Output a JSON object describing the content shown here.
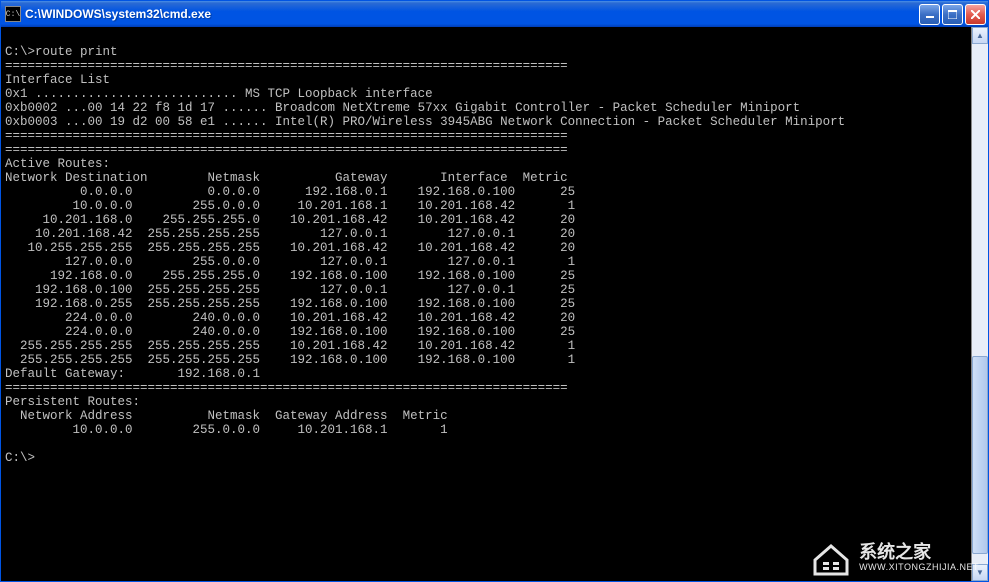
{
  "window": {
    "icon_text": "C:\\",
    "title": "C:\\WINDOWS\\system32\\cmd.exe"
  },
  "prompt": "C:\\>",
  "command": "route print",
  "divider": "===========================================================================",
  "interface_list_header": "Interface List",
  "interfaces": [
    {
      "id": "0x1",
      "dots": "...........................",
      "desc": "MS TCP Loopback interface"
    },
    {
      "id": "0xb0002",
      "mac": "...00 14 22 f8 1d 17 ......",
      "desc": "Broadcom NetXtreme 57xx Gigabit Controller - Packet Scheduler Miniport"
    },
    {
      "id": "0xb0003",
      "mac": "...00 19 d2 00 58 e1 ......",
      "desc": "Intel(R) PRO/Wireless 3945ABG Network Connection - Packet Scheduler Miniport"
    }
  ],
  "active_routes_header": "Active Routes:",
  "route_headers": [
    "Network Destination",
    "Netmask",
    "Gateway",
    "Interface",
    "Metric"
  ],
  "routes": [
    {
      "dest": "0.0.0.0",
      "mask": "0.0.0.0",
      "gw": "192.168.0.1",
      "if": "192.168.0.100",
      "metric": "25"
    },
    {
      "dest": "10.0.0.0",
      "mask": "255.0.0.0",
      "gw": "10.201.168.1",
      "if": "10.201.168.42",
      "metric": "1"
    },
    {
      "dest": "10.201.168.0",
      "mask": "255.255.255.0",
      "gw": "10.201.168.42",
      "if": "10.201.168.42",
      "metric": "20"
    },
    {
      "dest": "10.201.168.42",
      "mask": "255.255.255.255",
      "gw": "127.0.0.1",
      "if": "127.0.0.1",
      "metric": "20"
    },
    {
      "dest": "10.255.255.255",
      "mask": "255.255.255.255",
      "gw": "10.201.168.42",
      "if": "10.201.168.42",
      "metric": "20"
    },
    {
      "dest": "127.0.0.0",
      "mask": "255.0.0.0",
      "gw": "127.0.0.1",
      "if": "127.0.0.1",
      "metric": "1"
    },
    {
      "dest": "192.168.0.0",
      "mask": "255.255.255.0",
      "gw": "192.168.0.100",
      "if": "192.168.0.100",
      "metric": "25"
    },
    {
      "dest": "192.168.0.100",
      "mask": "255.255.255.255",
      "gw": "127.0.0.1",
      "if": "127.0.0.1",
      "metric": "25"
    },
    {
      "dest": "192.168.0.255",
      "mask": "255.255.255.255",
      "gw": "192.168.0.100",
      "if": "192.168.0.100",
      "metric": "25"
    },
    {
      "dest": "224.0.0.0",
      "mask": "240.0.0.0",
      "gw": "10.201.168.42",
      "if": "10.201.168.42",
      "metric": "20"
    },
    {
      "dest": "224.0.0.0",
      "mask": "240.0.0.0",
      "gw": "192.168.0.100",
      "if": "192.168.0.100",
      "metric": "25"
    },
    {
      "dest": "255.255.255.255",
      "mask": "255.255.255.255",
      "gw": "10.201.168.42",
      "if": "10.201.168.42",
      "metric": "1"
    },
    {
      "dest": "255.255.255.255",
      "mask": "255.255.255.255",
      "gw": "192.168.0.100",
      "if": "192.168.0.100",
      "metric": "1"
    }
  ],
  "default_gateway_label": "Default Gateway:",
  "default_gateway": "192.168.0.1",
  "persistent_header": "Persistent Routes:",
  "persistent_cols": [
    "Network Address",
    "Netmask",
    "Gateway Address",
    "Metric"
  ],
  "persistent_routes": [
    {
      "addr": "10.0.0.0",
      "mask": "255.0.0.0",
      "gw": "10.201.168.1",
      "metric": "1"
    }
  ],
  "prompt_end": "C:\\>",
  "watermark": {
    "cn": "系统之家",
    "en": "WWW.XITONGZHIJIA.NET"
  }
}
